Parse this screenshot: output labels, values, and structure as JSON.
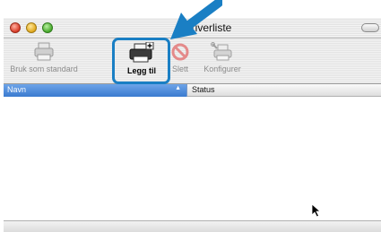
{
  "window": {
    "title": "Skriverliste"
  },
  "toolbar": {
    "items": [
      {
        "label": "Bruk som standard",
        "icon": "printer-icon",
        "enabled": false
      },
      {
        "label": "Legg til",
        "icon": "add-printer-icon",
        "enabled": true
      },
      {
        "label": "Slett",
        "icon": "delete-icon",
        "enabled": false
      },
      {
        "label": "Konfigurer",
        "icon": "configure-icon",
        "enabled": false
      }
    ]
  },
  "table": {
    "columns": [
      "Navn",
      "Status"
    ],
    "sort_indicator": "▲",
    "rows": []
  },
  "colors": {
    "highlight": "#1a7fc4",
    "header_selected": "#3a7ad0"
  }
}
